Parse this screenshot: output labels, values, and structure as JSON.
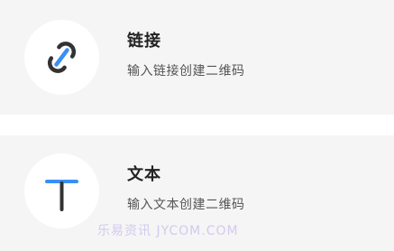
{
  "options": [
    {
      "icon": "link-icon",
      "title": "链接",
      "subtitle": "输入链接创建二维码"
    },
    {
      "icon": "text-icon",
      "title": "文本",
      "subtitle": "输入文本创建二维码"
    }
  ],
  "watermark": "乐易资讯  JYCOM.COM",
  "colors": {
    "accent_blue": "#3a8ff5",
    "icon_dark": "#333333",
    "card_background": "#f5f5f5"
  }
}
